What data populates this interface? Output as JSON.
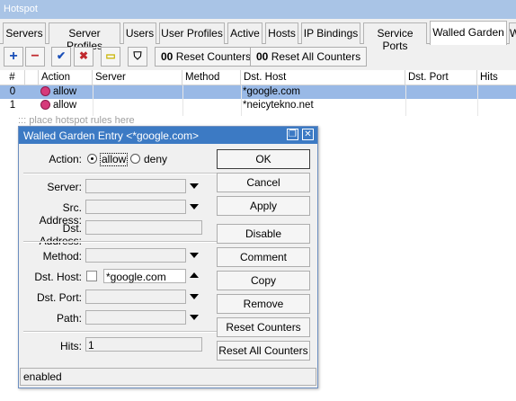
{
  "window": {
    "title": "Hotspot"
  },
  "tabs": [
    {
      "label": "Servers"
    },
    {
      "label": "Server Profiles"
    },
    {
      "label": "Users"
    },
    {
      "label": "User Profiles"
    },
    {
      "label": "Active"
    },
    {
      "label": "Hosts"
    },
    {
      "label": "IP Bindings"
    },
    {
      "label": "Service Ports"
    },
    {
      "label": "Walled Garden"
    },
    {
      "label": "W"
    }
  ],
  "toolbar": {
    "add": "+",
    "remove": "−",
    "enable": "✔",
    "disable": "✖",
    "comment": "▭",
    "filter": "⛉",
    "reset_counters_prefix": "00",
    "reset_counters": "Reset Counters",
    "reset_all_prefix": "00",
    "reset_all_counters": "Reset All Counters"
  },
  "table": {
    "columns": [
      "#",
      "Action",
      "Server",
      "Method",
      "Dst. Host",
      "Dst. Port",
      "Hits"
    ],
    "rows": [
      {
        "num": "0",
        "action": "allow",
        "dst_host": "*google.com"
      },
      {
        "num": "1",
        "action": "allow",
        "dst_host": "*neicytekno.net"
      }
    ],
    "comment": "::: place hotspot rules here"
  },
  "dialog": {
    "title": "Walled Garden Entry <*google.com>",
    "restore": "❐",
    "close": "✕",
    "action_label": "Action:",
    "action_allow": "allow",
    "action_deny": "deny",
    "server_label": "Server:",
    "src_address_label": "Src. Address:",
    "dst_address_label": "Dst. Address:",
    "method_label": "Method:",
    "dst_host_label": "Dst. Host:",
    "dst_host_value": "*google.com",
    "dst_port_label": "Dst. Port:",
    "path_label": "Path:",
    "hits_label": "Hits:",
    "hits_value": "1",
    "buttons": {
      "ok": "OK",
      "cancel": "Cancel",
      "apply": "Apply",
      "disable": "Disable",
      "comment": "Comment",
      "copy": "Copy",
      "remove": "Remove",
      "reset_counters": "Reset Counters",
      "reset_all_counters": "Reset All Counters"
    },
    "status": "enabled"
  },
  "colors": {
    "accent_titlebar": "#3c7ac4",
    "selected_row": "#99b9e6",
    "add_icon": "#1a4fb8",
    "remove_icon": "#c0282d"
  }
}
